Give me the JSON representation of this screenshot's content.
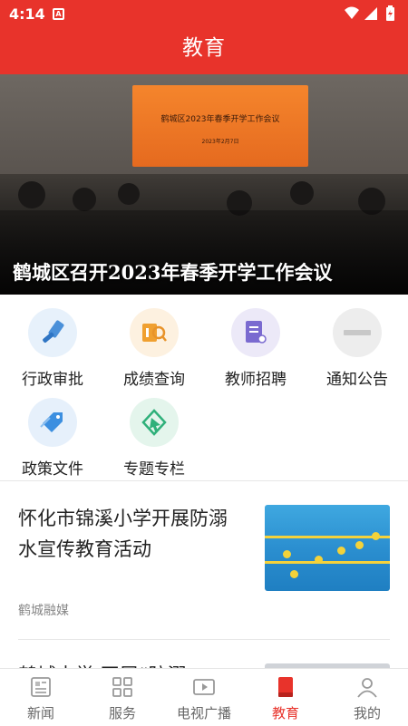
{
  "status_bar": {
    "time": "4:14",
    "notification_glyph": "A"
  },
  "header": {
    "title": "教育"
  },
  "banner": {
    "caption": "鹤城区召开2023年春季开学工作会议",
    "screen_title": "鹤城区2023年春季开学工作会议",
    "screen_date": "2023年2月7日"
  },
  "services": [
    {
      "label": "行政审批",
      "icon": "gavel-icon",
      "color": "#4a90d9"
    },
    {
      "label": "成绩查询",
      "icon": "search-doc-icon",
      "color": "#f0a030"
    },
    {
      "label": "教师招聘",
      "icon": "resume-icon",
      "color": "#7a6ad0"
    },
    {
      "label": "通知公告",
      "icon": "notice-logo-icon",
      "color": "#bbbbbb"
    },
    {
      "label": "政策文件",
      "icon": "tag-icon",
      "color": "#3c8fe0"
    },
    {
      "label": "专题专栏",
      "icon": "cursor-icon",
      "color": "#2fb07a"
    }
  ],
  "articles": [
    {
      "title": "怀化市锦溪小学开展防溺水宣传教育活动",
      "source": "鹤城融媒"
    },
    {
      "title": "鹤城中学 开展“防溺"
    }
  ],
  "tabs": [
    {
      "label": "新闻",
      "icon": "newspaper-icon"
    },
    {
      "label": "服务",
      "icon": "grid-icon"
    },
    {
      "label": "电视广播",
      "icon": "tv-icon"
    },
    {
      "label": "教育",
      "icon": "book-icon",
      "active": true
    },
    {
      "label": "我的",
      "icon": "user-icon"
    }
  ],
  "colors": {
    "brand": "#e8332b"
  }
}
